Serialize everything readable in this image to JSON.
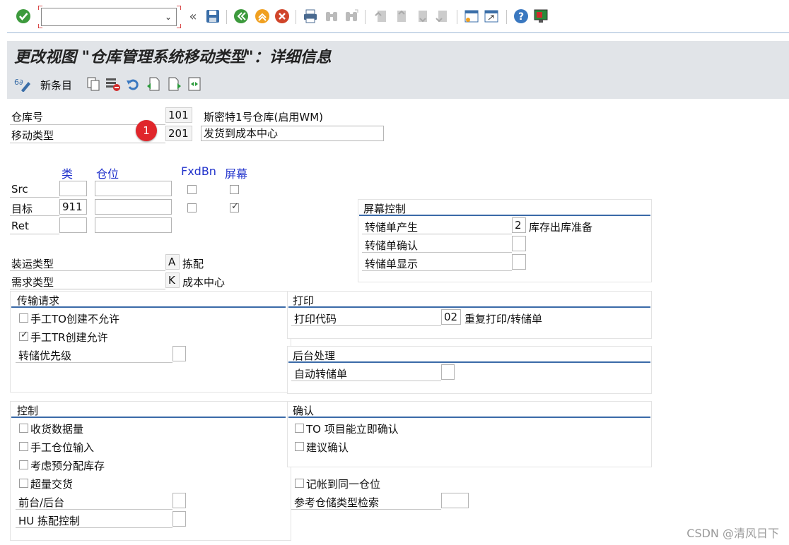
{
  "title": "更改视图 \"仓库管理系统移动类型\"：详细信息",
  "app_toolbar": {
    "new_entry_label": "新条目"
  },
  "header": {
    "warehouse_label": "仓库号",
    "warehouse_value": "101",
    "warehouse_desc": "斯密特1号仓库(启用WM)",
    "movement_label": "移动类型",
    "movement_value": "201",
    "movement_desc": "发货到成本中心",
    "badge": "1"
  },
  "bins": {
    "col_type": "类",
    "col_bin": "仓位",
    "col_fxd": "FxdBn",
    "col_screen": "屏幕",
    "rows": [
      {
        "label": "Src",
        "type": "",
        "bin": "",
        "fxd": false,
        "screen": false
      },
      {
        "label": "目标",
        "type": "911",
        "bin": "",
        "fxd": false,
        "screen": true
      },
      {
        "label": "Ret",
        "type": "",
        "bin": ""
      }
    ]
  },
  "screen_control": {
    "title": "屏幕控制",
    "rows": [
      {
        "label": "转储单产生",
        "value": "2",
        "desc": "库存出库准备"
      },
      {
        "label": "转储单确认",
        "value": ""
      },
      {
        "label": "转储单显示",
        "value": ""
      }
    ]
  },
  "shipping_type": {
    "label": "装运类型",
    "value": "A",
    "desc": "拣配"
  },
  "requirement_type": {
    "label": "需求类型",
    "value": "K",
    "desc": "成本中心"
  },
  "transfer_request": {
    "title": "传输请求",
    "cb1": "手工TO创建不允许",
    "cb1_checked": false,
    "cb2": "手工TR创建允许",
    "cb2_checked": true,
    "priority_label": "转储优先级",
    "priority_value": ""
  },
  "print": {
    "title": "打印",
    "code_label": "打印代码",
    "code_value": "02",
    "code_desc": "重复打印/转储单"
  },
  "background": {
    "title": "后台处理",
    "auto_label": "自动转储单",
    "auto_value": ""
  },
  "control": {
    "title": "控制",
    "cb1": "收货数据量",
    "cb2": "手工仓位输入",
    "cb3": "考虑预分配库存",
    "cb4": "超量交货",
    "front_back_label": "前台/后台",
    "front_back_value": "",
    "hu_label": "HU 拣配控制",
    "hu_value": ""
  },
  "confirm": {
    "title": "确认",
    "cb1": "TO 项目能立即确认",
    "cb2": "建议确认"
  },
  "misc": {
    "same_bin_label": "记帐到同一仓位",
    "ref_search_label": "参考仓储类型检索",
    "ref_search_value": ""
  },
  "watermark": "CSDN @清风日下"
}
